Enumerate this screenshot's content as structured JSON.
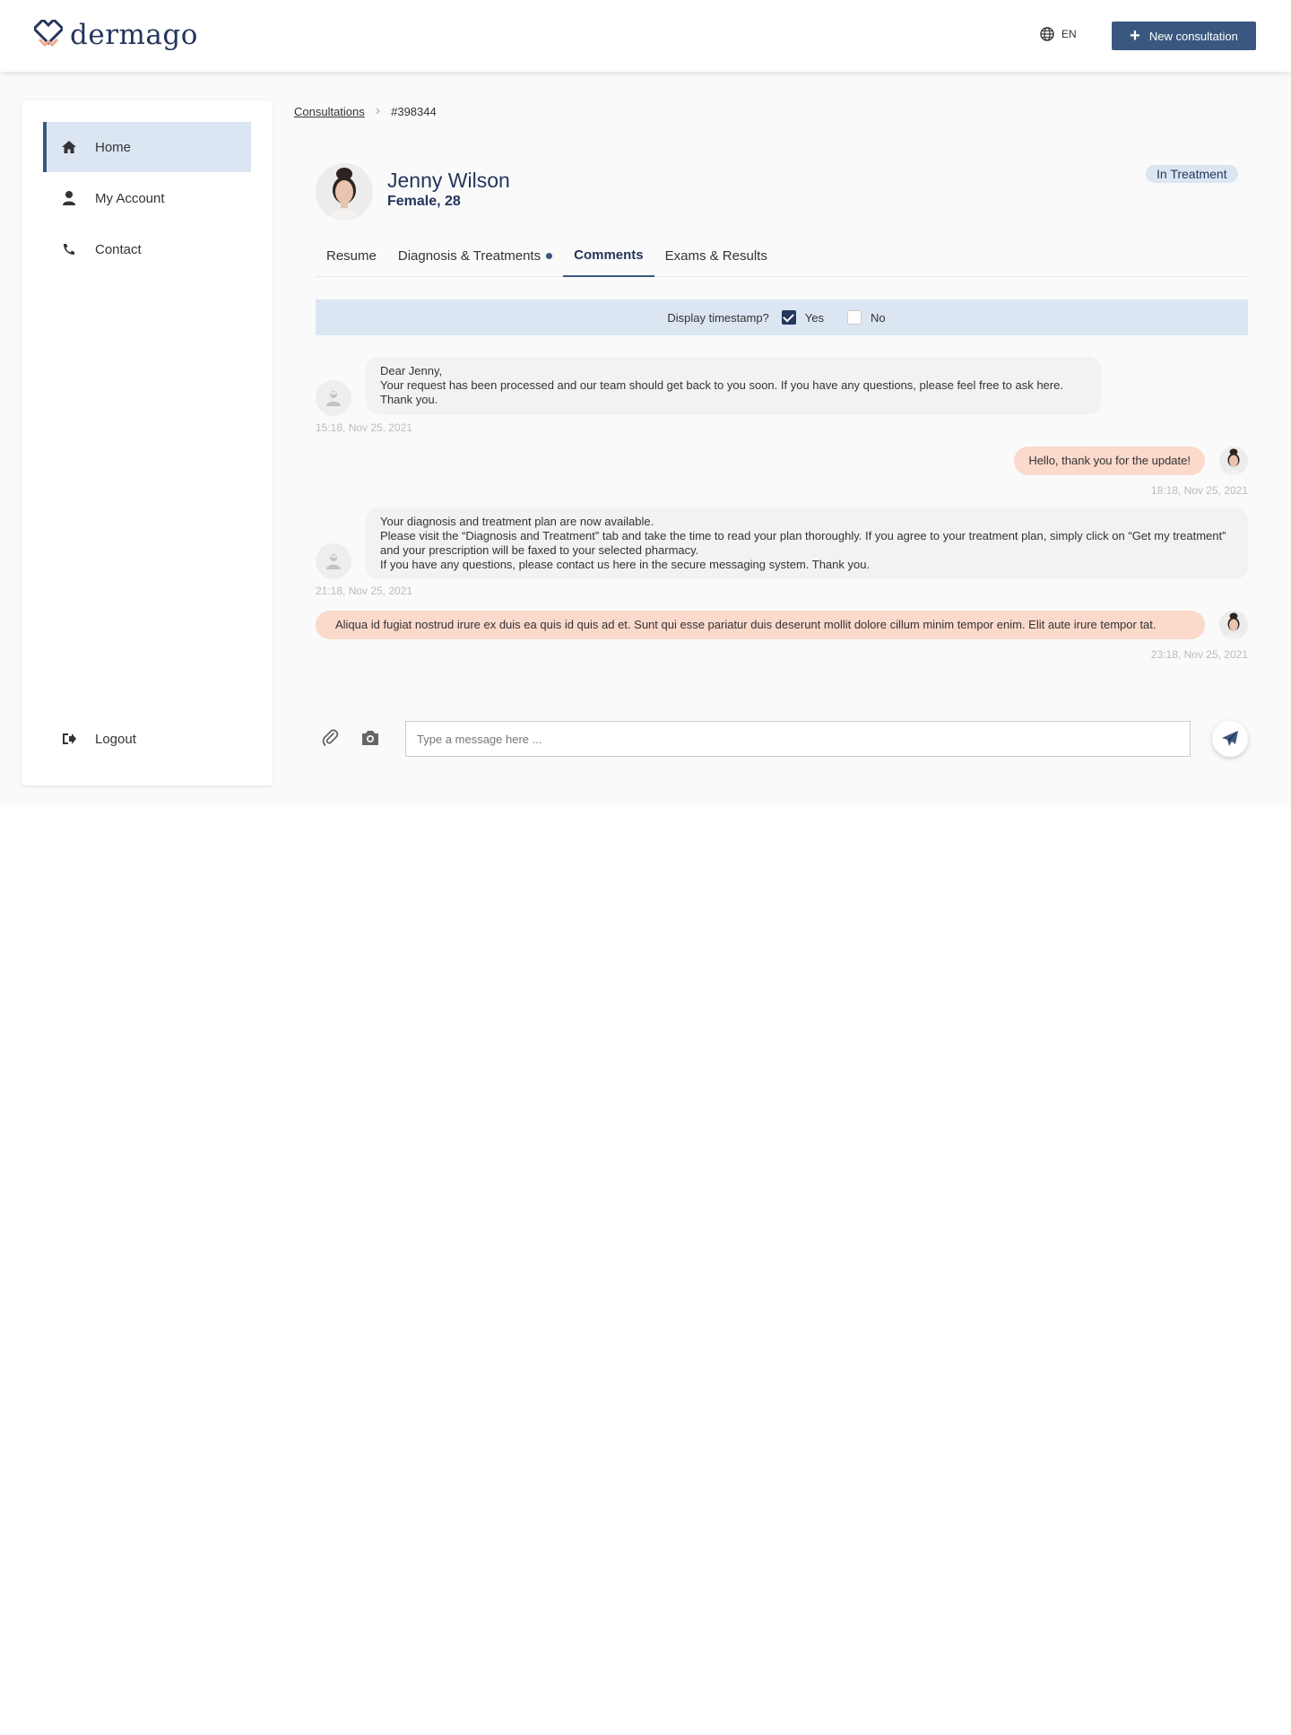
{
  "header": {
    "logo_text": "dermago",
    "language": "EN",
    "new_consultation_label": "New consultation",
    "accent": "#3a587f"
  },
  "sidebar": {
    "items": [
      {
        "label": "Home",
        "icon": "home-icon",
        "active": true
      },
      {
        "label": "My Account",
        "icon": "user-icon"
      },
      {
        "label": "Contact",
        "icon": "phone-icon"
      }
    ],
    "logout_label": "Logout"
  },
  "breadcrumb": {
    "parent": "Consultations",
    "current": "#398344"
  },
  "patient": {
    "name": "Jenny Wilson",
    "details": "Female, 28",
    "status": "In Treatment"
  },
  "tabs": [
    {
      "label": "Resume"
    },
    {
      "label": "Diagnosis & Treatments",
      "dot": true
    },
    {
      "label": "Comments",
      "active": true
    },
    {
      "label": "Exams & Results"
    }
  ],
  "timestamp_toggle": {
    "label": "Display timestamp?",
    "yes_label": "Yes",
    "no_label": "No",
    "selected": "Yes"
  },
  "messages": [
    {
      "from": "doctor",
      "lines": [
        "Dear Jenny,",
        "Your request has been processed and our team should get back to you soon. If you have any questions, please feel free to ask here.",
        "Thank you."
      ],
      "time": "15:18, Nov 25, 2021"
    },
    {
      "from": "patient",
      "lines": [
        "Hello, thank you for the update!"
      ],
      "time": "18:18, Nov 25, 2021"
    },
    {
      "from": "doctor",
      "lines": [
        "Your diagnosis and treatment plan are now available.",
        "Please visit the “Diagnosis and Treatment” tab and take the time to read your plan thoroughly. If you agree to your treatment plan, simply click on “Get my treatment” and your prescription will be faxed to your selected pharmacy.",
        "If you have any questions, please contact us here in the secure messaging system. Thank you."
      ],
      "time": "21:18, Nov 25, 2021"
    },
    {
      "from": "patient",
      "lines": [
        "Aliqua id fugiat nostrud irure ex duis ea quis id quis ad et. Sunt qui esse pariatur duis deserunt mollit dolore cillum minim tempor enim. Elit aute irure tempor tat."
      ],
      "time": "23:18, Nov 25, 2021"
    }
  ],
  "composer": {
    "placeholder": "Type a message here ..."
  }
}
